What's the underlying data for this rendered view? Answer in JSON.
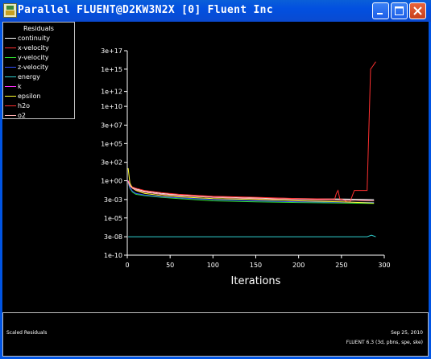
{
  "window": {
    "title": "Parallel FLUENT@D2KW3N2X [0] Fluent Inc"
  },
  "legend": {
    "title": "Residuals",
    "items": [
      {
        "label": "continuity",
        "color": "#ffffff"
      },
      {
        "label": "x-velocity",
        "color": "#ff3030"
      },
      {
        "label": "y-velocity",
        "color": "#30e030"
      },
      {
        "label": "z-velocity",
        "color": "#3050ff"
      },
      {
        "label": "energy",
        "color": "#30d0d0"
      },
      {
        "label": "k",
        "color": "#ff30ff"
      },
      {
        "label": "epsilon",
        "color": "#ffff30"
      },
      {
        "label": "h2o",
        "color": "#ff3030"
      },
      {
        "label": "o2",
        "color": "#ffb0b0"
      }
    ]
  },
  "chart_data": {
    "type": "line",
    "title": "",
    "xlabel": "Iterations",
    "ylabel": "",
    "yscale": "log",
    "xlim": [
      0,
      300
    ],
    "ylim": [
      1e-10,
      3e+17
    ],
    "x_ticks": [
      0,
      50,
      100,
      150,
      200,
      250,
      300
    ],
    "x_tick_labels": [
      "0",
      "50",
      "100",
      "150",
      "200",
      "250",
      "300"
    ],
    "y_ticks": [
      1e-10,
      3e-08,
      1e-05,
      0.003,
      1,
      300,
      100000.0,
      30000000.0,
      10000000000.0,
      1000000000000.0,
      1000000000000000.0,
      3e+17
    ],
    "y_tick_labels": [
      "1e-10",
      "3e-08",
      "1e-05",
      "3e-03",
      "1e+00",
      "3e+02",
      "1e+05",
      "3e+07",
      "1e+10",
      "1e+12",
      "1e+15",
      "3e+17"
    ],
    "grid": false,
    "legend_position": "top-left",
    "series": [
      {
        "name": "continuity",
        "color": "#ffffff",
        "x": [
          1,
          3,
          6,
          10,
          20,
          40,
          60,
          100,
          150,
          200,
          250,
          288
        ],
        "y": [
          1,
          0.3,
          0.12,
          0.08,
          0.04,
          0.02,
          0.012,
          0.007,
          0.005,
          0.004,
          0.0035,
          0.003
        ]
      },
      {
        "name": "x-velocity",
        "color": "#ff3030",
        "x": [
          1,
          3,
          6,
          10,
          20,
          40,
          60,
          100,
          150,
          200,
          240,
          242,
          244,
          246,
          248,
          252,
          256,
          260,
          265,
          268,
          280,
          284,
          287,
          290
        ],
        "y": [
          1,
          0.3,
          0.15,
          0.1,
          0.05,
          0.025,
          0.015,
          0.008,
          0.006,
          0.004,
          0.0035,
          0.003,
          0.02,
          0.05,
          0.004,
          0.003,
          0.0015,
          0.0015,
          0.05,
          0.05,
          0.05,
          1000000000000000.0,
          3000000000000000.0,
          1e+16
        ]
      },
      {
        "name": "y-velocity",
        "color": "#30e030",
        "x": [
          1,
          3,
          6,
          10,
          20,
          40,
          60,
          100,
          150,
          200,
          250,
          288
        ],
        "y": [
          0.5,
          0.1,
          0.03,
          0.015,
          0.01,
          0.006,
          0.004,
          0.002,
          0.0015,
          0.0012,
          0.001,
          0.0009
        ]
      },
      {
        "name": "z-velocity",
        "color": "#3050ff",
        "x": [
          1,
          3,
          6,
          10,
          20,
          40,
          60,
          100,
          150,
          200,
          250,
          288
        ],
        "y": [
          0.6,
          0.12,
          0.04,
          0.02,
          0.012,
          0.007,
          0.005,
          0.003,
          0.002,
          0.0015,
          0.0013,
          0.0012
        ]
      },
      {
        "name": "energy",
        "color": "#30d0d0",
        "x": [
          1,
          5,
          50,
          100,
          150,
          200,
          250,
          280,
          285,
          290
        ],
        "y": [
          3e-08,
          3e-08,
          3e-08,
          3e-08,
          3e-08,
          3e-08,
          3e-08,
          3e-08,
          5e-08,
          3e-08
        ]
      },
      {
        "name": "k",
        "color": "#ff30ff",
        "x": [
          1,
          3,
          6,
          10,
          20,
          40,
          60,
          100,
          150,
          200,
          250,
          288
        ],
        "y": [
          1,
          0.3,
          0.1,
          0.06,
          0.03,
          0.015,
          0.01,
          0.006,
          0.004,
          0.003,
          0.0025,
          0.002
        ]
      },
      {
        "name": "epsilon",
        "color": "#ffff30",
        "x": [
          1,
          3,
          6,
          10,
          20,
          40,
          60,
          100,
          150,
          200,
          250,
          288
        ],
        "y": [
          50,
          0.5,
          0.1,
          0.05,
          0.02,
          0.01,
          0.007,
          0.004,
          0.003,
          0.002,
          0.0015,
          0.001
        ]
      },
      {
        "name": "h2o",
        "color": "#ff3030",
        "x": [
          1,
          3,
          6,
          10,
          20,
          40,
          60,
          100,
          150,
          200,
          250,
          288
        ],
        "y": [
          0.8,
          0.2,
          0.1,
          0.06,
          0.03,
          0.015,
          0.01,
          0.006,
          0.004,
          0.003,
          0.0025,
          0.002
        ]
      },
      {
        "name": "o2",
        "color": "#ffb0b0",
        "x": [
          1,
          3,
          6,
          10,
          20,
          40,
          60,
          100,
          150,
          200,
          250,
          288
        ],
        "y": [
          0.8,
          0.2,
          0.1,
          0.06,
          0.03,
          0.015,
          0.01,
          0.006,
          0.004,
          0.003,
          0.0025,
          0.002
        ]
      }
    ]
  },
  "footer": {
    "left_label": "Scaled Residuals",
    "date": "Sep 25, 2010",
    "version": "FLUENT 6.3 (3d, pbns, spe, ske)"
  }
}
